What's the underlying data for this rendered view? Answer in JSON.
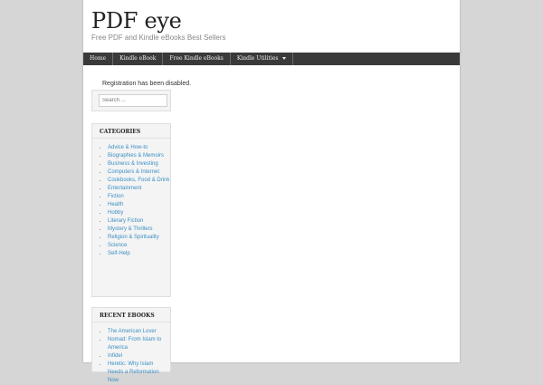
{
  "site": {
    "title": "PDF eye",
    "tagline": "Free PDF and Kindle eBooks Best Sellers"
  },
  "nav": {
    "items": [
      "Home",
      "Kindle eBook",
      "Free Kindle eBooks",
      "Kindle Utilities"
    ]
  },
  "notice": "Registration has been disabled.",
  "search": {
    "placeholder": "Search ..."
  },
  "categories": {
    "title": "CATEGORIES",
    "items": [
      "Advice & How-to",
      "Biographies & Memoirs",
      "Business & Investing",
      "Computers & Internet",
      "Cookbooks, Food & Drink",
      "Entertainment",
      "Fiction",
      "Health",
      "Hobby",
      "Literary Fiction",
      "Mystery & Thrillers",
      "Religion & Spirituality",
      "Science",
      "Self-Help"
    ]
  },
  "recent": {
    "title": "RECENT EBOOKS",
    "items": [
      "The American Lover",
      "Nomad: From Islam to America",
      "Infidel",
      "Heretic: Why Islam Needs a Reformation Now"
    ]
  },
  "colors": {
    "link": "#3a8fc4",
    "nav_bg": "#3a3a3a",
    "page_bg": "#d6d6d6"
  }
}
